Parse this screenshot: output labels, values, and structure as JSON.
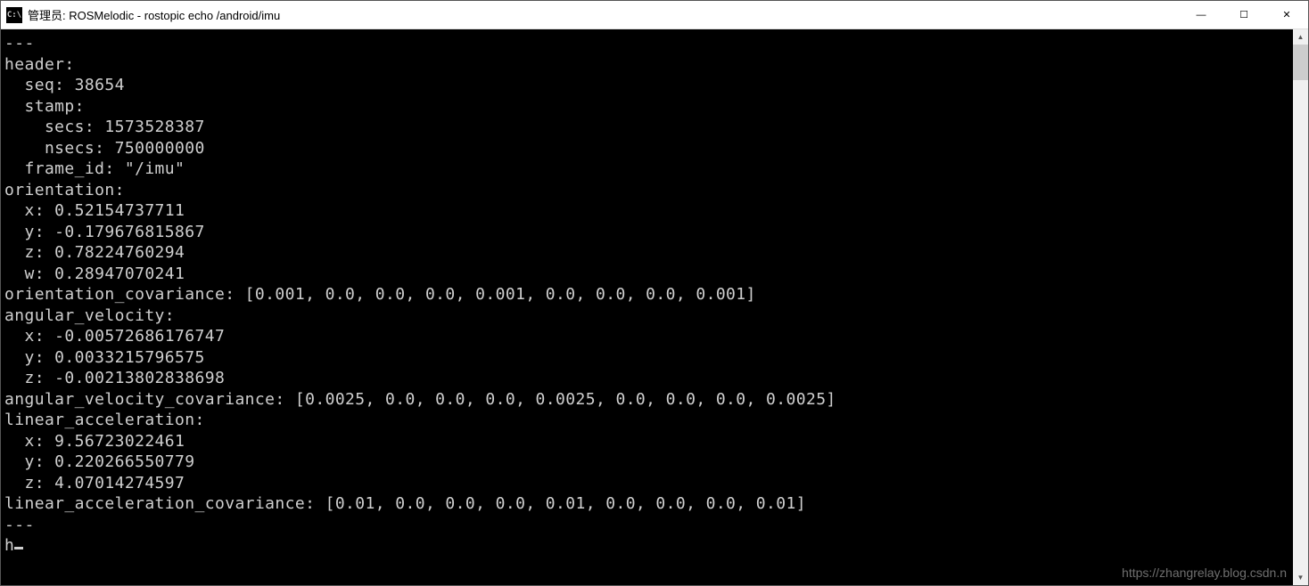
{
  "window": {
    "icon_label": "C:\\",
    "title": "管理员: ROSMelodic - rostopic  echo  /android/imu"
  },
  "controls": {
    "minimize_glyph": "—",
    "maximize_glyph": "☐",
    "close_glyph": "✕"
  },
  "scrollbar": {
    "up_glyph": "▲",
    "down_glyph": "▼"
  },
  "console": {
    "lines": [
      "---",
      "header:",
      "  seq: 38654",
      "  stamp:",
      "    secs: 1573528387",
      "    nsecs: 750000000",
      "  frame_id: \"/imu\"",
      "orientation:",
      "  x: 0.52154737711",
      "  y: -0.179676815867",
      "  z: 0.78224760294",
      "  w: 0.28947070241",
      "orientation_covariance: [0.001, 0.0, 0.0, 0.0, 0.001, 0.0, 0.0, 0.0, 0.001]",
      "angular_velocity:",
      "  x: -0.00572686176747",
      "  y: 0.0033215796575",
      "  z: -0.00213802838698",
      "angular_velocity_covariance: [0.0025, 0.0, 0.0, 0.0, 0.0025, 0.0, 0.0, 0.0, 0.0025]",
      "linear_acceleration:",
      "  x: 9.56723022461",
      "  y: 0.220266550779",
      "  z: 4.07014274597",
      "linear_acceleration_covariance: [0.01, 0.0, 0.0, 0.0, 0.01, 0.0, 0.0, 0.0, 0.01]",
      "---"
    ],
    "partial_line": "h"
  },
  "watermark": "https://zhangrelay.blog.csdn.n"
}
